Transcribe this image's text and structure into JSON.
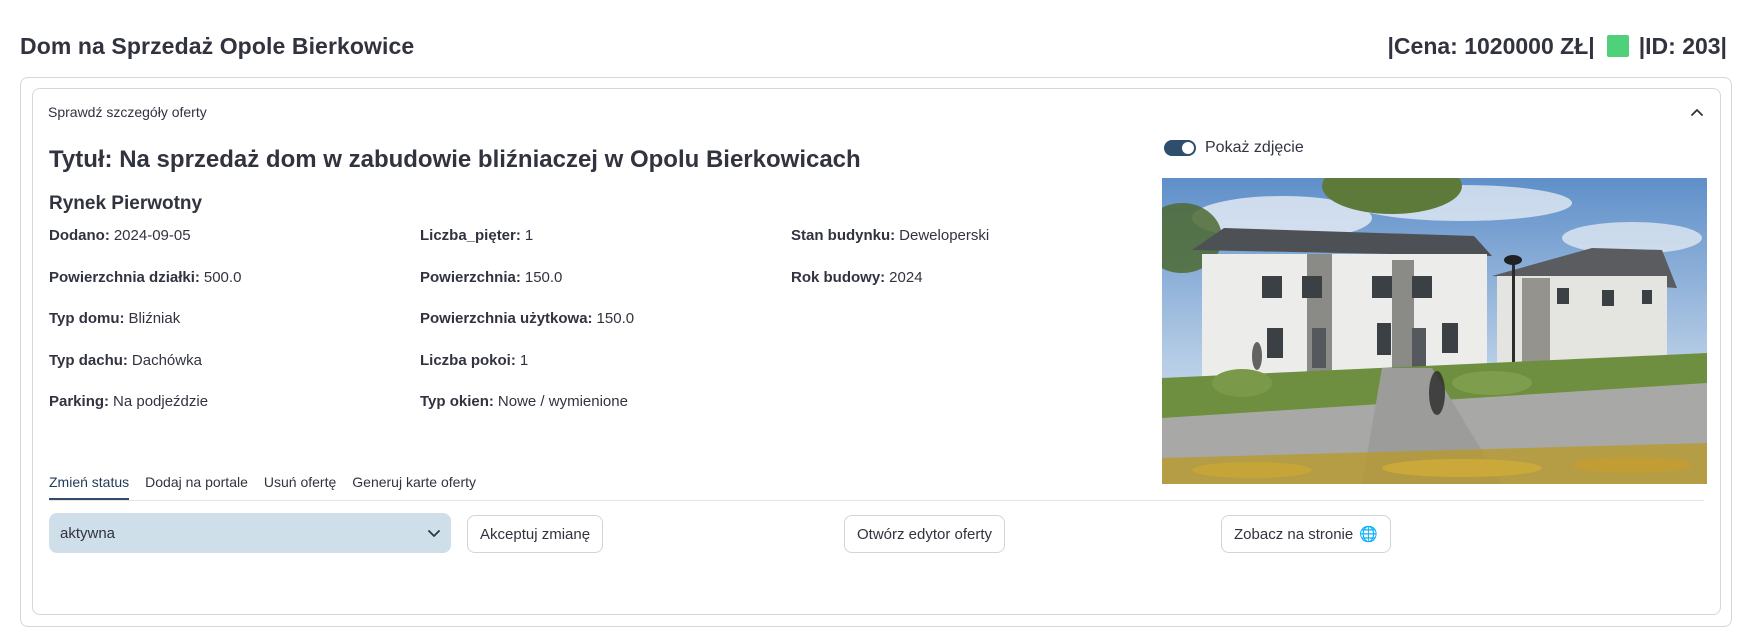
{
  "header": {
    "title": "Dom na Sprzedaż Opole Bierkowice",
    "price_text": "|Cena: 1020000 ZŁ|",
    "id_text": "|ID: 203|",
    "status_color": "#4fd07a"
  },
  "expander": {
    "label": "Sprawdź szczegóły oferty",
    "icon": "chevron-up-icon"
  },
  "offer": {
    "title": "Tytuł: Na sprzedaż dom w zabudowie bliźniaczej w Opolu Bierkowicach",
    "market": "Rynek Pierwotny",
    "details": [
      {
        "label": "Dodano:",
        "value": "2024-09-05"
      },
      {
        "label": "Liczba_pięter:",
        "value": "1"
      },
      {
        "label": "Stan budynku:",
        "value": "Deweloperski"
      },
      {
        "label": "Powierzchnia działki:",
        "value": "500.0"
      },
      {
        "label": "Powierzchnia:",
        "value": "150.0"
      },
      {
        "label": "Rok budowy:",
        "value": "2024"
      },
      {
        "label": "Typ domu:",
        "value": "Bliźniak"
      },
      {
        "label": "Powierzchnia użytkowa:",
        "value": "150.0"
      },
      {
        "label": "",
        "value": ""
      },
      {
        "label": "Typ dachu:",
        "value": "Dachówka"
      },
      {
        "label": "Liczba pokoi:",
        "value": "1"
      },
      {
        "label": "",
        "value": ""
      },
      {
        "label": "Parking:",
        "value": "Na podjeździe"
      },
      {
        "label": "Typ okien:",
        "value": "Nowe / wymienione"
      },
      {
        "label": "",
        "value": ""
      }
    ]
  },
  "photo_toggle": {
    "label": "Pokaż zdjęcie",
    "checked": true,
    "color": "#2e4e6b"
  },
  "tabs": [
    {
      "label": "Zmień status",
      "active": true
    },
    {
      "label": "Dodaj na portale",
      "active": false
    },
    {
      "label": "Usuń ofertę",
      "active": false
    },
    {
      "label": "Generuj karte oferty",
      "active": false
    }
  ],
  "status_select": {
    "value": "aktywna",
    "background": "#cfdfea"
  },
  "buttons": {
    "accept": "Akceptuj zmianę",
    "open_editor": "Otwórz edytor oferty",
    "view_on_site": "Zobacz na stronie",
    "view_icon": "globe-icon"
  }
}
